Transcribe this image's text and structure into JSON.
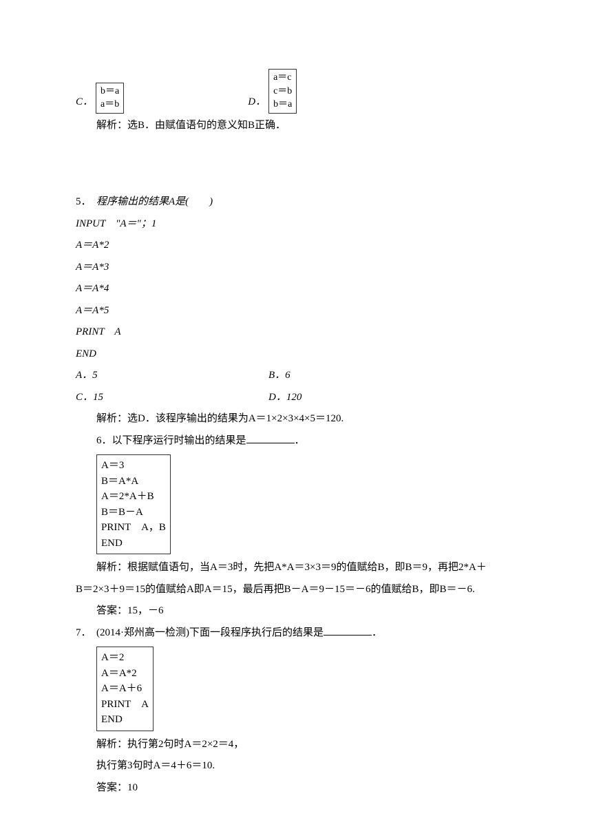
{
  "q4": {
    "optC": {
      "label": "C．",
      "lines": [
        "b＝a",
        "a＝b"
      ]
    },
    "optD": {
      "label": "D．",
      "lines": [
        "a＝c",
        "c＝b",
        "b＝a"
      ]
    },
    "explain": "解析：选B．由赋值语句的意义知B正确．"
  },
  "q5": {
    "num": "5．",
    "stem": "程序输出的结果A是(　　)",
    "code": [
      "INPUT　\"A＝\"；1",
      "A＝A*2",
      "A＝A*3",
      "A＝A*4",
      "A＝A*5",
      "PRINT　A",
      "END"
    ],
    "optA": "A．5",
    "optB": "B．6",
    "optC": "C．15",
    "optD": "D．120",
    "explain": "解析：选D．该程序输出的结果为A＝1×2×3×4×5＝120."
  },
  "q6": {
    "stem": "6．以下程序运行时输出的结果是",
    "blank_suffix": "．",
    "code": [
      "A＝3",
      "B＝A*A",
      "A＝2*A＋B",
      "B＝B－A",
      "PRINT　A，B",
      "END"
    ],
    "explain_line1": "解析：根据赋值语句，当A＝3时，先把A*A＝3×3＝9的值赋给B，即B＝9，再把2*A＋",
    "explain_line2": "B＝2×3＋9＝15的值赋给A即A＝15，最后再把B－A＝9－15＝－6的值赋给B，即B＝－6.",
    "answer": "答案：15，－6"
  },
  "q7": {
    "num": "7．",
    "stem": "(2014·郑州高一检测)下面一段程序执行后的结果是",
    "blank_suffix": "．",
    "code": [
      "A＝2",
      "A＝A*2",
      "A＝A＋6",
      "PRINT　A",
      "END"
    ],
    "explain_l1": "解析：执行第2句时A＝2×2＝4，",
    "explain_l2": "执行第3句时A＝4＋6＝10.",
    "answer": "答案：10"
  }
}
